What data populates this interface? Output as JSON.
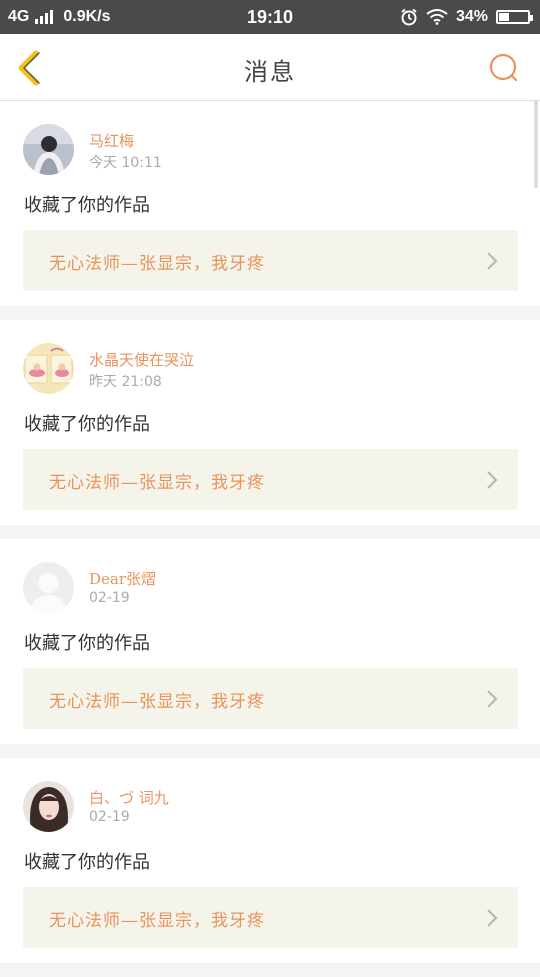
{
  "status": {
    "network": "4G",
    "speed": "0.9K/s",
    "time": "19:10",
    "battery": "34%",
    "battery_level": 0.34
  },
  "header": {
    "title": "消息",
    "back_icon": "chevron-left-icon",
    "search_icon": "search-icon"
  },
  "colors": {
    "accent": "#e9935c",
    "back_icon": "#f2c21a",
    "card_bg": "#f4f4ea"
  },
  "messages": [
    {
      "name": "马红梅",
      "time": "今天 10:11",
      "action": "收藏了你的作品",
      "work": "无心法师—张显宗，我牙疼"
    },
    {
      "name": "水晶天使在哭泣",
      "time": "昨天 21:08",
      "action": "收藏了你的作品",
      "work": "无心法师—张显宗，我牙疼"
    },
    {
      "name": "Dear张熠",
      "time": "02-19",
      "action": "收藏了你的作品",
      "work": "无心法师—张显宗，我牙疼"
    },
    {
      "name": "白、づ 词九",
      "time": "02-19",
      "action": "收藏了你的作品",
      "work": "无心法师—张显宗，我牙疼"
    }
  ]
}
